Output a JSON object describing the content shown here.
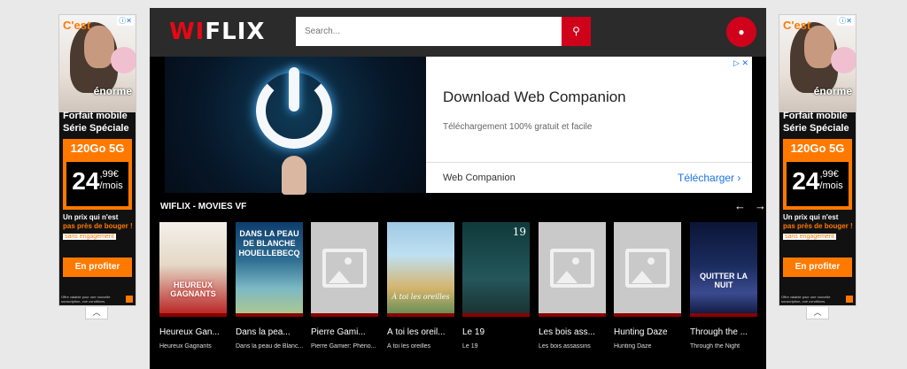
{
  "app": {
    "logo_wi": "WI",
    "logo_flix": "FLIX",
    "search_placeholder": "Search..."
  },
  "side_ad": {
    "cest": "C'est",
    "enorme": "énorme",
    "forfait_line1": "Forfait mobile",
    "forfait_line2": "Série Spéciale",
    "go": "120Go 5G",
    "price_main": "24",
    "price_cents": ",99€",
    "price_unit": "/mois",
    "prix_line1": "Un prix qui n'est",
    "prix_line2": "pas près de bouger !",
    "sans": "sans engagement",
    "cta": "En profiter",
    "legal": "Offre valable pour une nouvelle souscription, voir conditions."
  },
  "banner": {
    "title": "Download Web Companion",
    "subtitle": "Téléchargement 100% gratuit et facile",
    "brand": "Web Companion",
    "cta": "Télécharger"
  },
  "section": {
    "title": "WIFLIX - MOVIES VF"
  },
  "movies": [
    {
      "title": "Heureux Gan...",
      "subtitle": "Heureux Gagnants",
      "poster_text": "HEUREUX GAGNANTS"
    },
    {
      "title": "Dans la pea...",
      "subtitle": "Dans la peau de Blanc...",
      "poster_text": "DANS LA PEAU DE BLANCHE HOUELLEBECQ"
    },
    {
      "title": "Pierre Gami...",
      "subtitle": "Pierre Gamier: Phéno..."
    },
    {
      "title": "À toi les oreil...",
      "subtitle": "À toi les oreilles",
      "poster_text": "À toi les oreilles"
    },
    {
      "title": "Le 19",
      "subtitle": "Le 19",
      "poster_text": "19"
    },
    {
      "title": "Les bois ass...",
      "subtitle": "Les bois assassins"
    },
    {
      "title": "Hunting Daze",
      "subtitle": "Hunting Daze"
    },
    {
      "title": "Through the ...",
      "subtitle": "Through the Night",
      "poster_text": "QUITTER LA NUIT"
    }
  ]
}
